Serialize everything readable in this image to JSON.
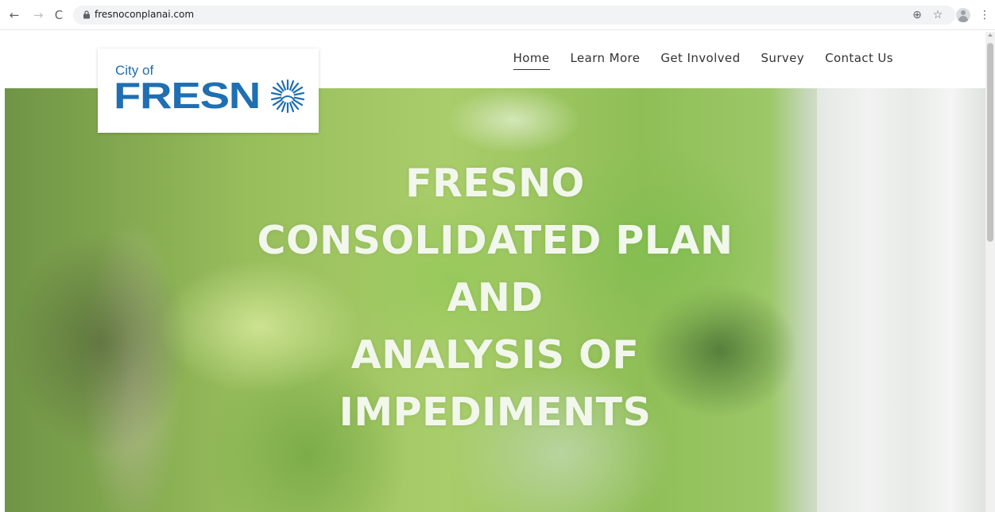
{
  "browser": {
    "back_icon": "←",
    "forward_icon": "→",
    "reload_icon": "C",
    "url": "fresnoconplanai.com",
    "add_icon": "⊕",
    "star_icon": "☆",
    "menu_icon": "⋮"
  },
  "logo": {
    "city_of": "City of",
    "word": "FRESN",
    "brand_color": "#1f6fb2"
  },
  "nav": {
    "items": [
      {
        "label": "Home",
        "active": true
      },
      {
        "label": "Learn More",
        "active": false
      },
      {
        "label": "Get Involved",
        "active": false
      },
      {
        "label": "Survey",
        "active": false
      },
      {
        "label": "Contact Us",
        "active": false
      }
    ]
  },
  "hero": {
    "title_lines": [
      "FRESNO",
      "CONSOLIDATED PLAN",
      "AND",
      "ANALYSIS OF",
      "IMPEDIMENTS"
    ]
  }
}
